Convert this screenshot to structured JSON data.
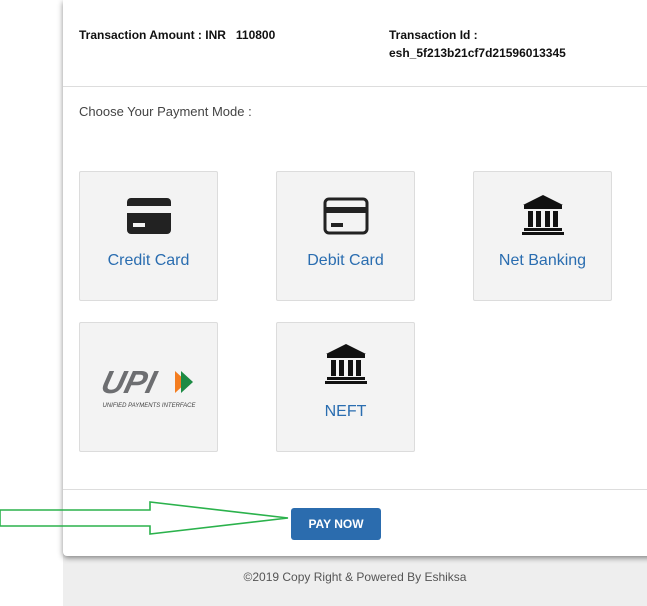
{
  "transaction": {
    "amount_text": "Transaction Amount : INR   110800",
    "id_label": "Transaction Id :",
    "id_value": "esh_5f213b21cf7d21596013345"
  },
  "choose_label": "Choose Your Payment Mode :",
  "payment_modes": [
    {
      "label": "Credit Card",
      "icon": "credit-card-icon"
    },
    {
      "label": "Debit Card",
      "icon": "debit-card-icon"
    },
    {
      "label": "Net Banking",
      "icon": "bank-icon"
    },
    {
      "label": "",
      "icon": "upi-logo",
      "logo_text": "UPI",
      "logo_subtext": "UNIFIED PAYMENTS INTERFACE"
    },
    {
      "label": "NEFT",
      "icon": "bank-icon"
    }
  ],
  "pay_button_label": "PAY NOW",
  "footer_text": "©2019 Copy Right & Powered By Eshiksa",
  "colors": {
    "accent": "#2b6cae",
    "link": "#2a6db0",
    "arrow": "#2bb24c",
    "tile_bg": "#f3f3f3"
  }
}
